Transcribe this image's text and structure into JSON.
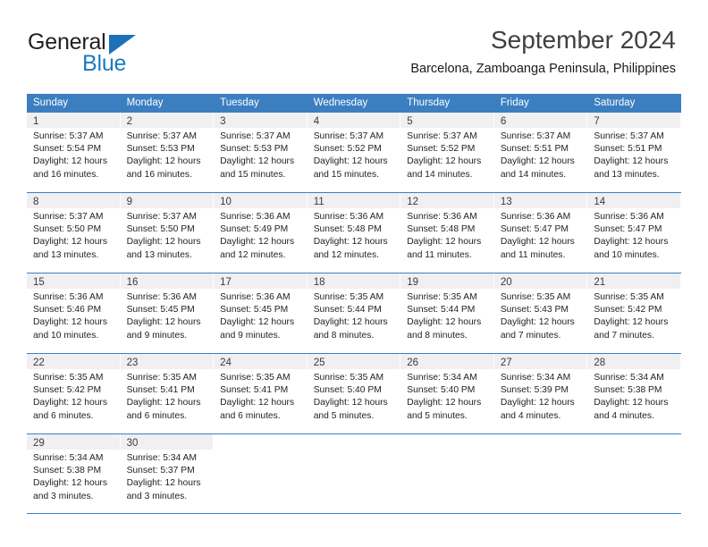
{
  "brand": {
    "name_part1": "General",
    "name_part2": "Blue",
    "color_primary": "#1c7ac0",
    "color_dark": "#231f20"
  },
  "header": {
    "title": "September 2024",
    "subtitle": "Barcelona, Zamboanga Peninsula, Philippines"
  },
  "theme": {
    "header_blue": "#3c7fc0",
    "daynum_band": "#f0f0f0",
    "text": "#232323"
  },
  "calendar": {
    "weekday_headers": [
      "Sunday",
      "Monday",
      "Tuesday",
      "Wednesday",
      "Thursday",
      "Friday",
      "Saturday"
    ],
    "weeks": [
      [
        {
          "day": "1",
          "sunrise": "Sunrise: 5:37 AM",
          "sunset": "Sunset: 5:54 PM",
          "daylight_line1": "Daylight: 12 hours",
          "daylight_line2": "and 16 minutes."
        },
        {
          "day": "2",
          "sunrise": "Sunrise: 5:37 AM",
          "sunset": "Sunset: 5:53 PM",
          "daylight_line1": "Daylight: 12 hours",
          "daylight_line2": "and 16 minutes."
        },
        {
          "day": "3",
          "sunrise": "Sunrise: 5:37 AM",
          "sunset": "Sunset: 5:53 PM",
          "daylight_line1": "Daylight: 12 hours",
          "daylight_line2": "and 15 minutes."
        },
        {
          "day": "4",
          "sunrise": "Sunrise: 5:37 AM",
          "sunset": "Sunset: 5:52 PM",
          "daylight_line1": "Daylight: 12 hours",
          "daylight_line2": "and 15 minutes."
        },
        {
          "day": "5",
          "sunrise": "Sunrise: 5:37 AM",
          "sunset": "Sunset: 5:52 PM",
          "daylight_line1": "Daylight: 12 hours",
          "daylight_line2": "and 14 minutes."
        },
        {
          "day": "6",
          "sunrise": "Sunrise: 5:37 AM",
          "sunset": "Sunset: 5:51 PM",
          "daylight_line1": "Daylight: 12 hours",
          "daylight_line2": "and 14 minutes."
        },
        {
          "day": "7",
          "sunrise": "Sunrise: 5:37 AM",
          "sunset": "Sunset: 5:51 PM",
          "daylight_line1": "Daylight: 12 hours",
          "daylight_line2": "and 13 minutes."
        }
      ],
      [
        {
          "day": "8",
          "sunrise": "Sunrise: 5:37 AM",
          "sunset": "Sunset: 5:50 PM",
          "daylight_line1": "Daylight: 12 hours",
          "daylight_line2": "and 13 minutes."
        },
        {
          "day": "9",
          "sunrise": "Sunrise: 5:37 AM",
          "sunset": "Sunset: 5:50 PM",
          "daylight_line1": "Daylight: 12 hours",
          "daylight_line2": "and 13 minutes."
        },
        {
          "day": "10",
          "sunrise": "Sunrise: 5:36 AM",
          "sunset": "Sunset: 5:49 PM",
          "daylight_line1": "Daylight: 12 hours",
          "daylight_line2": "and 12 minutes."
        },
        {
          "day": "11",
          "sunrise": "Sunrise: 5:36 AM",
          "sunset": "Sunset: 5:48 PM",
          "daylight_line1": "Daylight: 12 hours",
          "daylight_line2": "and 12 minutes."
        },
        {
          "day": "12",
          "sunrise": "Sunrise: 5:36 AM",
          "sunset": "Sunset: 5:48 PM",
          "daylight_line1": "Daylight: 12 hours",
          "daylight_line2": "and 11 minutes."
        },
        {
          "day": "13",
          "sunrise": "Sunrise: 5:36 AM",
          "sunset": "Sunset: 5:47 PM",
          "daylight_line1": "Daylight: 12 hours",
          "daylight_line2": "and 11 minutes."
        },
        {
          "day": "14",
          "sunrise": "Sunrise: 5:36 AM",
          "sunset": "Sunset: 5:47 PM",
          "daylight_line1": "Daylight: 12 hours",
          "daylight_line2": "and 10 minutes."
        }
      ],
      [
        {
          "day": "15",
          "sunrise": "Sunrise: 5:36 AM",
          "sunset": "Sunset: 5:46 PM",
          "daylight_line1": "Daylight: 12 hours",
          "daylight_line2": "and 10 minutes."
        },
        {
          "day": "16",
          "sunrise": "Sunrise: 5:36 AM",
          "sunset": "Sunset: 5:45 PM",
          "daylight_line1": "Daylight: 12 hours",
          "daylight_line2": "and 9 minutes."
        },
        {
          "day": "17",
          "sunrise": "Sunrise: 5:36 AM",
          "sunset": "Sunset: 5:45 PM",
          "daylight_line1": "Daylight: 12 hours",
          "daylight_line2": "and 9 minutes."
        },
        {
          "day": "18",
          "sunrise": "Sunrise: 5:35 AM",
          "sunset": "Sunset: 5:44 PM",
          "daylight_line1": "Daylight: 12 hours",
          "daylight_line2": "and 8 minutes."
        },
        {
          "day": "19",
          "sunrise": "Sunrise: 5:35 AM",
          "sunset": "Sunset: 5:44 PM",
          "daylight_line1": "Daylight: 12 hours",
          "daylight_line2": "and 8 minutes."
        },
        {
          "day": "20",
          "sunrise": "Sunrise: 5:35 AM",
          "sunset": "Sunset: 5:43 PM",
          "daylight_line1": "Daylight: 12 hours",
          "daylight_line2": "and 7 minutes."
        },
        {
          "day": "21",
          "sunrise": "Sunrise: 5:35 AM",
          "sunset": "Sunset: 5:42 PM",
          "daylight_line1": "Daylight: 12 hours",
          "daylight_line2": "and 7 minutes."
        }
      ],
      [
        {
          "day": "22",
          "sunrise": "Sunrise: 5:35 AM",
          "sunset": "Sunset: 5:42 PM",
          "daylight_line1": "Daylight: 12 hours",
          "daylight_line2": "and 6 minutes."
        },
        {
          "day": "23",
          "sunrise": "Sunrise: 5:35 AM",
          "sunset": "Sunset: 5:41 PM",
          "daylight_line1": "Daylight: 12 hours",
          "daylight_line2": "and 6 minutes."
        },
        {
          "day": "24",
          "sunrise": "Sunrise: 5:35 AM",
          "sunset": "Sunset: 5:41 PM",
          "daylight_line1": "Daylight: 12 hours",
          "daylight_line2": "and 6 minutes."
        },
        {
          "day": "25",
          "sunrise": "Sunrise: 5:35 AM",
          "sunset": "Sunset: 5:40 PM",
          "daylight_line1": "Daylight: 12 hours",
          "daylight_line2": "and 5 minutes."
        },
        {
          "day": "26",
          "sunrise": "Sunrise: 5:34 AM",
          "sunset": "Sunset: 5:40 PM",
          "daylight_line1": "Daylight: 12 hours",
          "daylight_line2": "and 5 minutes."
        },
        {
          "day": "27",
          "sunrise": "Sunrise: 5:34 AM",
          "sunset": "Sunset: 5:39 PM",
          "daylight_line1": "Daylight: 12 hours",
          "daylight_line2": "and 4 minutes."
        },
        {
          "day": "28",
          "sunrise": "Sunrise: 5:34 AM",
          "sunset": "Sunset: 5:38 PM",
          "daylight_line1": "Daylight: 12 hours",
          "daylight_line2": "and 4 minutes."
        }
      ],
      [
        {
          "day": "29",
          "sunrise": "Sunrise: 5:34 AM",
          "sunset": "Sunset: 5:38 PM",
          "daylight_line1": "Daylight: 12 hours",
          "daylight_line2": "and 3 minutes."
        },
        {
          "day": "30",
          "sunrise": "Sunrise: 5:34 AM",
          "sunset": "Sunset: 5:37 PM",
          "daylight_line1": "Daylight: 12 hours",
          "daylight_line2": "and 3 minutes."
        },
        {
          "day": "",
          "sunrise": "",
          "sunset": "",
          "daylight_line1": "",
          "daylight_line2": ""
        },
        {
          "day": "",
          "sunrise": "",
          "sunset": "",
          "daylight_line1": "",
          "daylight_line2": ""
        },
        {
          "day": "",
          "sunrise": "",
          "sunset": "",
          "daylight_line1": "",
          "daylight_line2": ""
        },
        {
          "day": "",
          "sunrise": "",
          "sunset": "",
          "daylight_line1": "",
          "daylight_line2": ""
        },
        {
          "day": "",
          "sunrise": "",
          "sunset": "",
          "daylight_line1": "",
          "daylight_line2": ""
        }
      ]
    ]
  }
}
